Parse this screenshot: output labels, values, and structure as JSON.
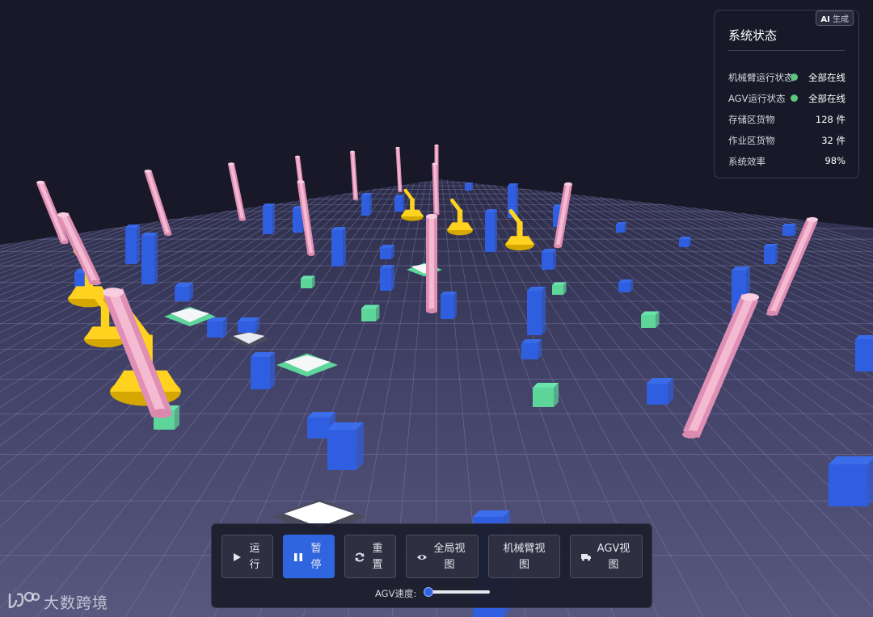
{
  "status_panel": {
    "badge": "AI 生成",
    "badge_ai": "AI",
    "badge_text": "生成",
    "title": "系统状态",
    "rows": [
      {
        "label": "机械臂运行状态",
        "value": "全部在线",
        "dot_color": "#5ec57d"
      },
      {
        "label": "AGV运行状态",
        "value": "全部在线",
        "dot_color": "#5ec57d"
      },
      {
        "label": "存储区货物",
        "value": "128 件"
      },
      {
        "label": "作业区货物",
        "value": "32 件"
      },
      {
        "label": "系统效率",
        "value": "98%"
      }
    ]
  },
  "controls": {
    "buttons": [
      {
        "name": "run-button",
        "icon": "play-icon",
        "line1": "运",
        "line2": "行",
        "active": false
      },
      {
        "name": "pause-button",
        "icon": "pause-icon",
        "line1": "暂",
        "line2": "停",
        "active": true
      },
      {
        "name": "reset-button",
        "icon": "refresh-icon",
        "line1": "重",
        "line2": "置",
        "active": false
      },
      {
        "name": "global-view-button",
        "icon": "eye-icon",
        "line1": "全局视",
        "line2": "图",
        "active": false
      },
      {
        "name": "arm-view-button",
        "icon": "",
        "line1": "机械臂视",
        "line2": "图",
        "active": false
      },
      {
        "name": "agv-view-button",
        "icon": "truck-icon",
        "line1": "AGV视",
        "line2": "图",
        "active": false
      }
    ],
    "speed_label": "AGV速度:",
    "speed_value": 0
  },
  "logo": {
    "text": "大数跨境"
  },
  "colors": {
    "accent": "#2f66e0",
    "floor": "#4a4a72",
    "grid": "#8c8cb8",
    "shelf_column": "#f0a8c8",
    "robot_arm": "#ffd21f",
    "cargo_blue": "#2f5fe0",
    "cargo_green": "#5ed69a",
    "online": "#5ec57d"
  }
}
